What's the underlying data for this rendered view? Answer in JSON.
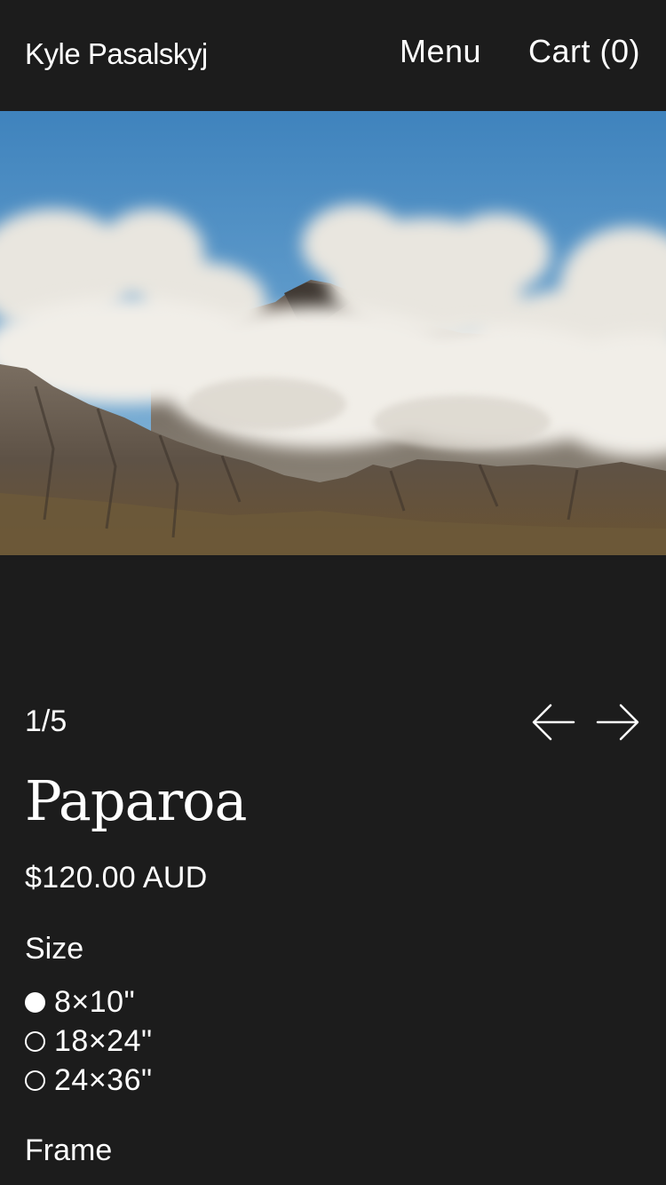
{
  "header": {
    "brand": "Kyle Pasalskyj",
    "menu_label": "Menu",
    "cart_label": "Cart (0)"
  },
  "gallery": {
    "image_alt": "Mountain peaks surrounded by clouds under a blue sky",
    "counter": "1/5",
    "prev_icon": "arrow-left-icon",
    "next_icon": "arrow-right-icon"
  },
  "product": {
    "title": "Paparoa",
    "price": "$120.00 AUD",
    "size_label": "Size",
    "sizes": [
      {
        "label": "8×10\"",
        "selected": true
      },
      {
        "label": "18×24\"",
        "selected": false
      },
      {
        "label": "24×36\"",
        "selected": false
      }
    ],
    "frame_label": "Frame"
  },
  "colors": {
    "background": "#1c1c1c",
    "text": "#ffffff",
    "sky": "#4f8fc4"
  }
}
